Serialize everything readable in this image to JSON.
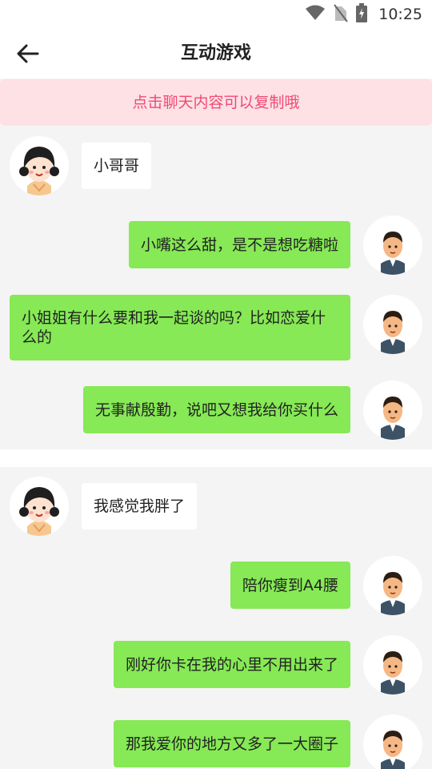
{
  "status_bar": {
    "time": "10:25",
    "icons": [
      "wifi-icon",
      "no-sim-icon",
      "battery-charging-icon"
    ]
  },
  "header": {
    "title": "互动游戏",
    "back_icon": "arrow-left-icon"
  },
  "notice": {
    "text": "点击聊天内容可以复制哦"
  },
  "cards": [
    {
      "prompt": "小哥哥",
      "replies": [
        "小嘴这么甜，是不是想吃糖啦",
        "小姐姐有什么要和我一起谈的吗？比如恋爱什么的",
        "无事献殷勤，说吧又想我给你买什么"
      ]
    },
    {
      "prompt": "我感觉我胖了",
      "replies": [
        "陪你瘦到A4腰",
        "刚好你卡在我的心里不用出来了",
        "那我爱你的地方又多了一大圈子"
      ]
    }
  ],
  "colors": {
    "accent_pink": "#f04a73",
    "notice_bg": "#fde1e5",
    "reply_bubble": "#86e955",
    "prompt_bubble": "#ffffff"
  }
}
